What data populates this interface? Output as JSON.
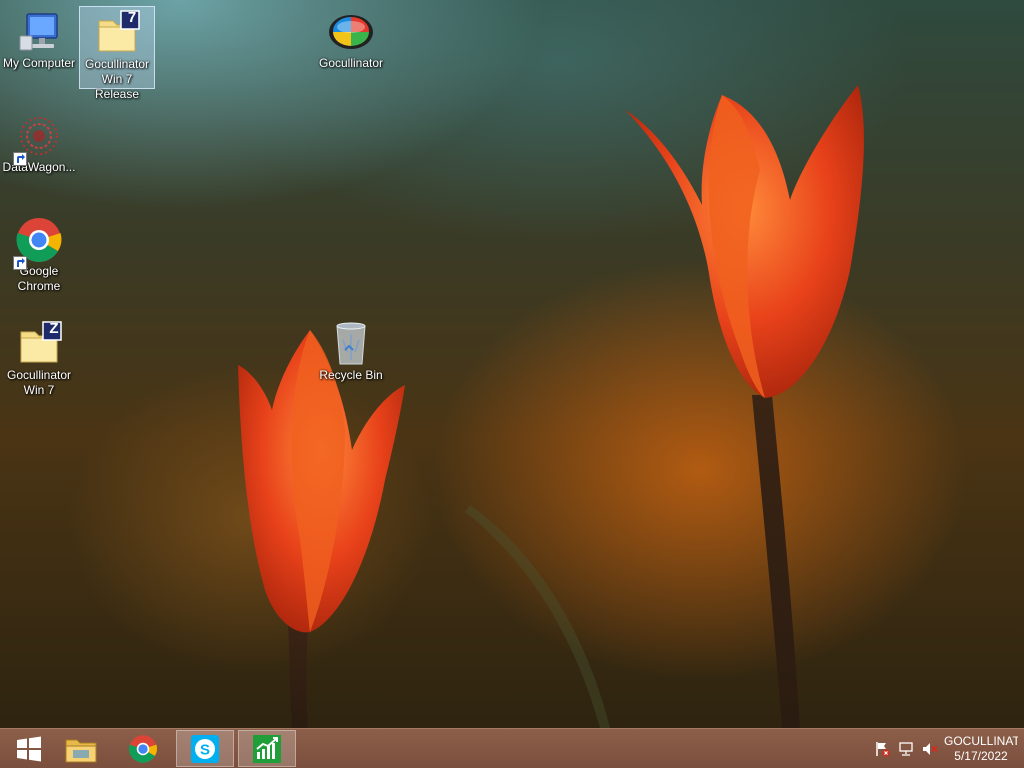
{
  "desktop": {
    "icons": [
      {
        "label": "My Computer"
      },
      {
        "label": "Gocullinator\nWin 7 Release",
        "badge": "7"
      },
      {
        "label": "Gocullinator"
      },
      {
        "label": "DataWagon..."
      },
      {
        "label": "Google\nChrome"
      },
      {
        "label": "Gocullinator\nWin 7",
        "badge": "Z"
      },
      {
        "label": "Recycle Bin"
      }
    ]
  },
  "taskbar": {
    "buttons": [
      {
        "icon": "windows-start-icon"
      },
      {
        "icon": "file-explorer-icon"
      },
      {
        "icon": "chrome-icon"
      },
      {
        "icon": "skype-icon"
      },
      {
        "icon": "stock-chart-app-icon"
      }
    ],
    "tray": {
      "icons": [
        "action-center-flag-icon",
        "network-icon",
        "volume-muted-icon"
      ],
      "clock_name": "GOCULLINAT",
      "clock_date": "5/17/2022"
    }
  },
  "colors": {
    "taskbar": "#7b4f3d",
    "tulip": "#e8421a",
    "selection": "#c8e1ff"
  }
}
